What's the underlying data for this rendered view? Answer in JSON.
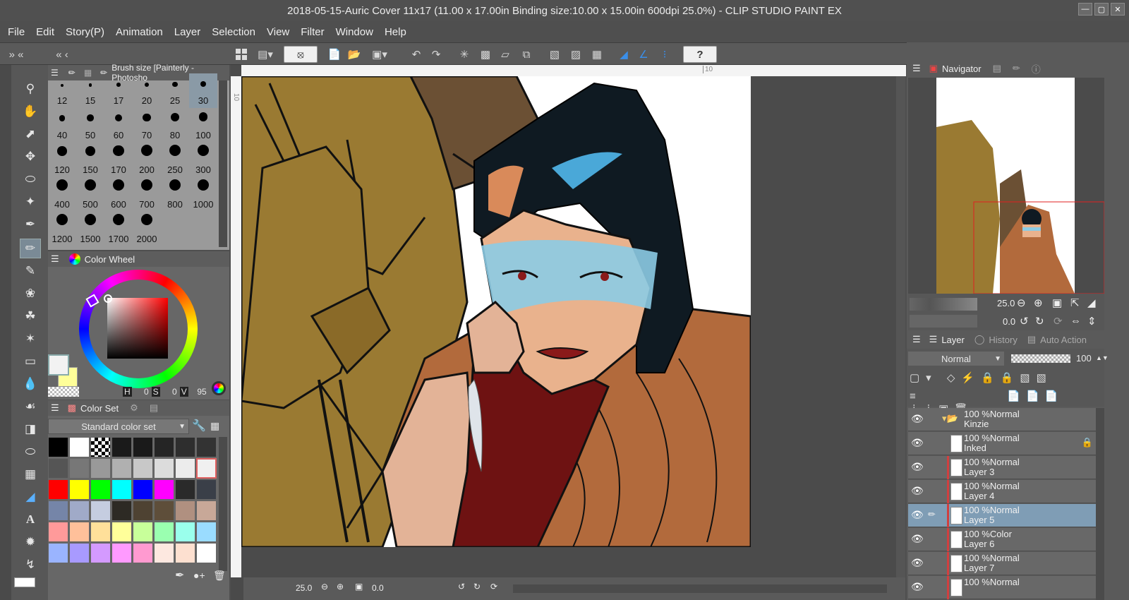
{
  "window": {
    "title": "2018-05-15-Auric Cover 11x17 (11.00 x 17.00in Binding size:10.00 x 15.00in 600dpi 25.0%) - CLIP STUDIO PAINT EX"
  },
  "menu": [
    "File",
    "Edit",
    "Story(P)",
    "Animation",
    "Layer",
    "Selection",
    "View",
    "Filter",
    "Window",
    "Help"
  ],
  "brush_panel": {
    "title": "Brush size [Painterly - Photosho",
    "sizes": [
      "12",
      "15",
      "17",
      "20",
      "25",
      "30",
      "40",
      "50",
      "60",
      "70",
      "80",
      "100",
      "120",
      "150",
      "170",
      "200",
      "250",
      "300",
      "400",
      "500",
      "600",
      "700",
      "800",
      "1000",
      "1200",
      "1500",
      "1700",
      "2000"
    ],
    "selected": "30"
  },
  "color_wheel": {
    "title": "Color Wheel",
    "h_label": "H",
    "h": "0",
    "s_label": "S",
    "s": "0",
    "v_label": "V",
    "v": "95"
  },
  "color_set": {
    "title": "Color Set",
    "dropdown": "Standard color set",
    "swatches": [
      "#000000",
      "#ffffff",
      "checker",
      "#1a1a1a",
      "#1a1a1a",
      "#252525",
      "#2e2e2e",
      "#333333",
      "#555555",
      "#777777",
      "#999999",
      "#b0b0b0",
      "#c8c8c8",
      "#dcdcdc",
      "#ececec",
      "#f0f0f0",
      "#ff0000",
      "#ffff00",
      "#00ff00",
      "#00ffff",
      "#0000ff",
      "#ff00ff",
      "#2a2a2a",
      "#3a3f48",
      "#7585a8",
      "#a0aac8",
      "#c5cde0",
      "#2d2a24",
      "#4e4232",
      "#5e4e3a",
      "#b09080",
      "#c8a898",
      "#ff9a9a",
      "#ffc09a",
      "#ffe09a",
      "#ffff9a",
      "#c8ff9a",
      "#9affb0",
      "#9affec",
      "#9adcff",
      "#9ab4ff",
      "#a89aff",
      "#d49aff",
      "#ff9aff",
      "#ff9ad0",
      "#fde8e0",
      "#fde0d0",
      "#ffffff"
    ]
  },
  "canvas": {
    "ruler_label": "10",
    "ruler_v_label": "10"
  },
  "status": {
    "zoom": "25.0",
    "angle": "0.0"
  },
  "navigator": {
    "title": "Navigator",
    "zoom": "25.0",
    "rotation": "0.0"
  },
  "layer_panel": {
    "tabs": [
      "Layer",
      "History",
      "Auto Action"
    ],
    "blend": "Normal",
    "opacity": "100",
    "layers": [
      {
        "pct": "100 %",
        "mode": "Normal",
        "name": "Kinzie",
        "folder": true
      },
      {
        "pct": "100 %",
        "mode": "Normal",
        "name": "Inked",
        "locked": true
      },
      {
        "pct": "100 %",
        "mode": "Normal",
        "name": "Layer 3"
      },
      {
        "pct": "100 %",
        "mode": "Normal",
        "name": "Layer 4"
      },
      {
        "pct": "100 %",
        "mode": "Normal",
        "name": "Layer 5",
        "selected": true
      },
      {
        "pct": "100 %",
        "mode": "Color",
        "name": "Layer 6"
      },
      {
        "pct": "100 %",
        "mode": "Normal",
        "name": "Layer 7"
      },
      {
        "pct": "100 %",
        "mode": "Normal",
        "name": ""
      }
    ]
  }
}
